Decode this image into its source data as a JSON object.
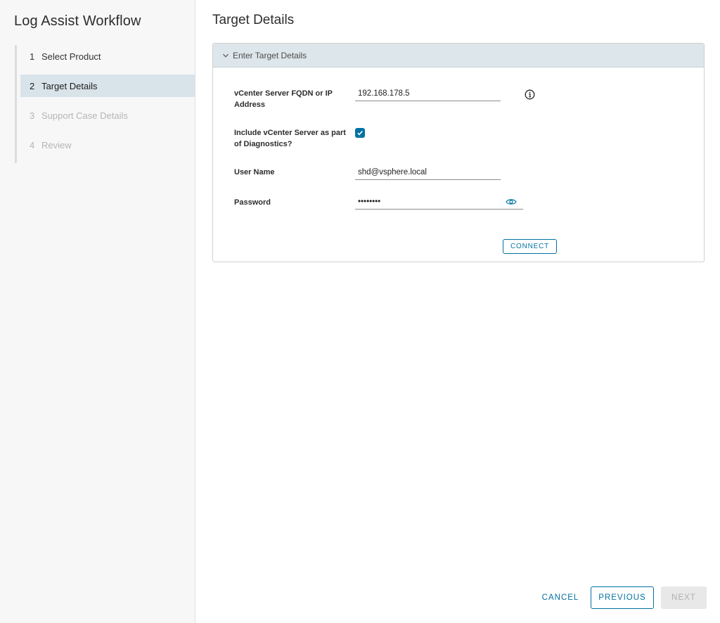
{
  "sidebar": {
    "title": "Log Assist Workflow",
    "steps": [
      {
        "num": "1",
        "label": "Select Product",
        "state": "complete"
      },
      {
        "num": "2",
        "label": "Target Details",
        "state": "active"
      },
      {
        "num": "3",
        "label": "Support Case Details",
        "state": "disabled"
      },
      {
        "num": "4",
        "label": "Review",
        "state": "disabled"
      }
    ]
  },
  "main": {
    "title": "Target Details",
    "panel": {
      "header": "Enter Target Details",
      "fields": {
        "fqdn_label": "vCenter Server FQDN or IP Address",
        "fqdn_value": "192.168.178.5",
        "include_label": "Include vCenter Server as part of Diagnostics?",
        "include_checked": true,
        "username_label": "User Name",
        "username_value": "shd@vsphere.local",
        "password_label": "Password",
        "password_value": "••••••••"
      },
      "connect_label": "CONNECT"
    }
  },
  "footer": {
    "cancel_label": "CANCEL",
    "previous_label": "PREVIOUS",
    "next_label": "NEXT"
  },
  "colors": {
    "accent": "#0072a3",
    "active_step_bg": "#d9e4ea",
    "panel_header_bg": "#dde6ea"
  }
}
